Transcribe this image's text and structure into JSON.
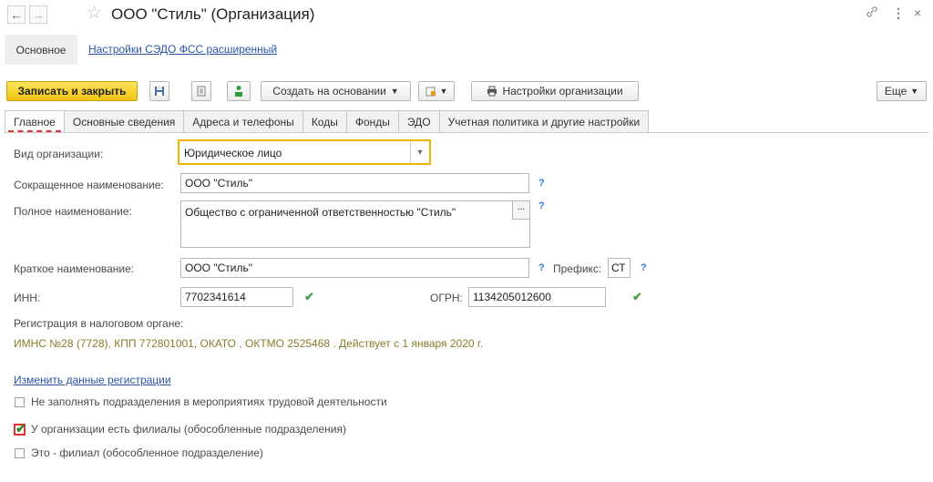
{
  "window": {
    "title": "ООО \"Стиль\" (Организация)",
    "back_glyph": "←",
    "forward_glyph": "→",
    "star_glyph": "☆",
    "link_glyph": "🔗",
    "menu_glyph": "⋮",
    "close_glyph": "×"
  },
  "top_nav": {
    "active": "Основное",
    "link": "Настройки СЭДО ФСС расширенный"
  },
  "toolbar": {
    "save_close": "Записать и закрыть",
    "create_based": "Создать на основании",
    "org_settings": "Настройки организации",
    "more": "Еще"
  },
  "tabs": [
    "Главное",
    "Основные сведения",
    "Адреса и телефоны",
    "Коды",
    "Фонды",
    "ЭДО",
    "Учетная политика и другие настройки"
  ],
  "form": {
    "org_type_label": "Вид организации:",
    "org_type_value": "Юридическое лицо",
    "short_name_label": "Сокращенное наименование:",
    "short_name_value": "ООО \"Стиль\"",
    "full_name_label": "Полное наименование:",
    "full_name_value": "Общество с ограниченной ответственностью \"Стиль\"",
    "brief_name_label": "Краткое наименование:",
    "brief_name_value": "ООО \"Стиль\"",
    "prefix_label": "Префикс:",
    "prefix_value": "СТ",
    "inn_label": "ИНН:",
    "inn_value": "7702341614",
    "ogrn_label": "ОГРН:",
    "ogrn_value": "1134205012600",
    "help_glyph": "?",
    "ok_glyph": "✔",
    "ellipsis": "...",
    "dropdown_arrow": "▾"
  },
  "registration": {
    "label": "Регистрация в налоговом органе:",
    "info": "ИМНС №28 (7728), КПП 772801001, ОКАТО , ОКТМО 2525468   . Действует с 1 января 2020 г.",
    "change_link": "Изменить данные регистрации"
  },
  "checkboxes": [
    {
      "label": "Не заполнять подразделения в мероприятиях трудовой деятельности",
      "checked": false
    },
    {
      "label": "У организации есть филиалы (обособленные подразделения)",
      "checked": true
    },
    {
      "label": "Это - филиал (обособленное подразделение)",
      "checked": false
    }
  ],
  "colors": {
    "primary_button": "#f1c40f",
    "link": "#2a55a5",
    "active_input_border": "#f0b400",
    "ok": "#3fa33f",
    "help": "#2a7bd6",
    "highlight": "#e03030"
  }
}
